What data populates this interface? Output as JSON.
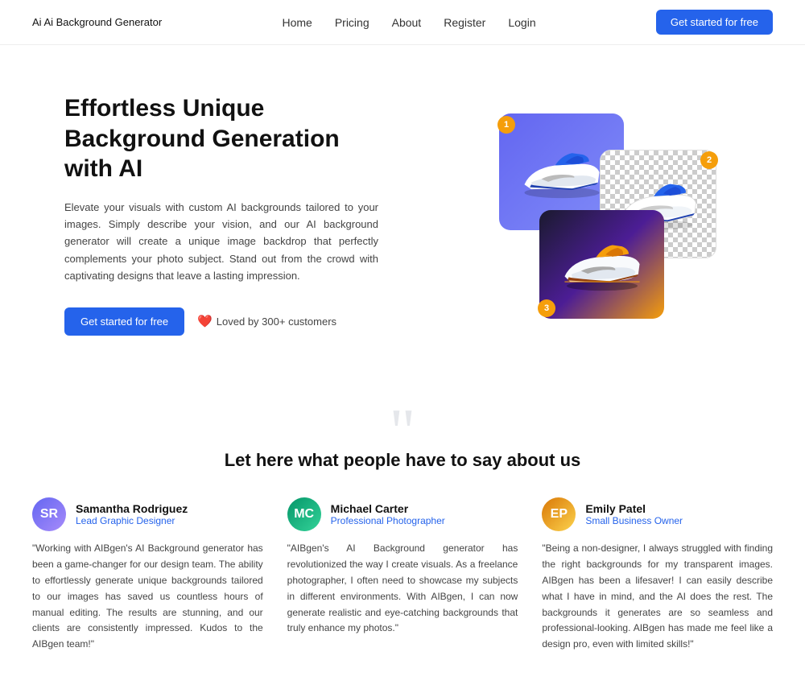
{
  "nav": {
    "logo": "Ai Background Generator",
    "links": [
      {
        "id": "home",
        "label": "Home"
      },
      {
        "id": "pricing",
        "label": "Pricing"
      },
      {
        "id": "about",
        "label": "About"
      },
      {
        "id": "register",
        "label": "Register"
      },
      {
        "id": "login",
        "label": "Login"
      }
    ],
    "cta_label": "Get started for free"
  },
  "hero": {
    "heading": "Effortless Unique Background Generation with AI",
    "description": "Elevate your visuals with custom AI backgrounds tailored to your images. Simply describe your vision, and our AI background generator will create a unique image backdrop that perfectly complements your photo subject. Stand out from the crowd with captivating designs that leave a lasting impression.",
    "cta_label": "Get started for free",
    "loved_label": "Loved by 300+ customers",
    "badge1": "1",
    "badge2": "2",
    "badge3": "3"
  },
  "testimonials": {
    "quote_mark": "“",
    "title": "Let here what people have to say about us",
    "reviews": [
      {
        "id": "review-1",
        "name": "Samantha Rodriguez",
        "title": "Lead Graphic Designer",
        "avatar_initials": "SR",
        "text": "\"Working with AIBgen's AI Background generator has been a game-changer for our design team. The ability to effortlessly generate unique backgrounds tailored to our images has saved us countless hours of manual editing. The results are stunning, and our clients are consistently impressed. Kudos to the AIBgen team!\""
      },
      {
        "id": "review-2",
        "name": "Michael Carter",
        "title": "Professional Photographer",
        "avatar_initials": "MC",
        "text": "\"AIBgen's AI Background generator has revolutionized the way I create visuals. As a freelance photographer, I often need to showcase my subjects in different environments. With AIBgen, I can now generate realistic and eye-catching backgrounds that truly enhance my photos.\""
      },
      {
        "id": "review-3",
        "name": "Emily Patel",
        "title": "Small Business Owner",
        "avatar_initials": "EP",
        "text": "\"Being a non-designer, I always struggled with finding the right backgrounds for my transparent images. AIBgen has been a lifesaver! I can easily describe what I have in mind, and the AI does the rest. The backgrounds it generates are so seamless and professional-looking. AIBgen has made me feel like a design pro, even with limited skills!\""
      }
    ]
  }
}
